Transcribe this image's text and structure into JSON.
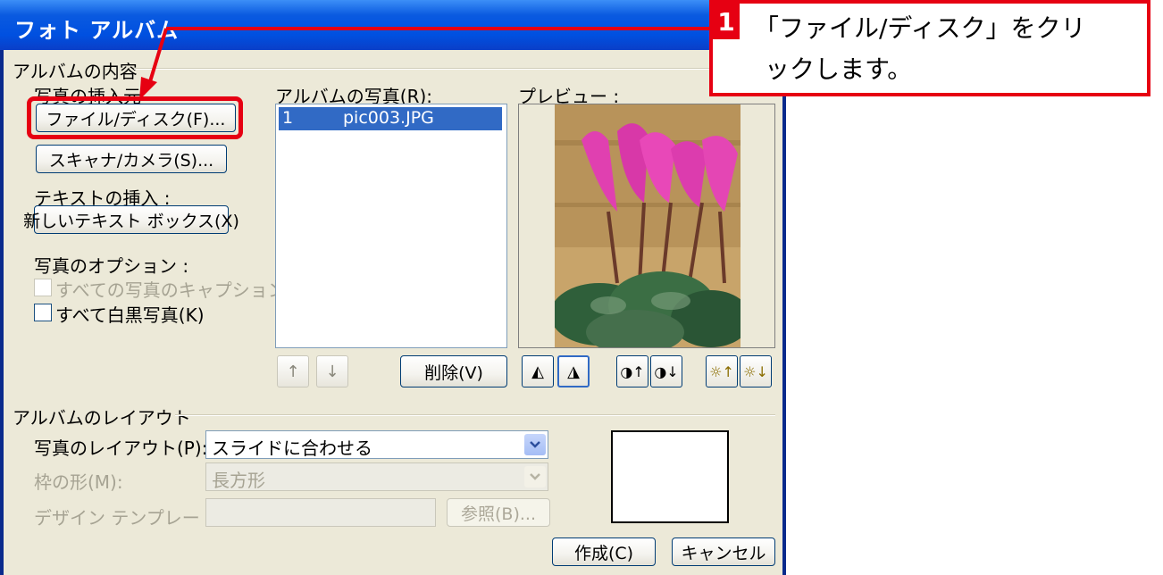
{
  "dialog": {
    "title": "フォト アルバム",
    "album_content": {
      "group_label": "アルバムの内容",
      "insert_photo_label": "写真の挿入元",
      "file_disk_button": "ファイル/ディスク(F)...",
      "scanner_camera_button": "スキャナ/カメラ(S)...",
      "insert_text_label": "テキストの挿入 :",
      "new_textbox_button": "新しいテキスト ボックス(X)",
      "photo_options_label": "写真のオプション :",
      "caption_checkbox_label": "すべての写真のキャプション(A)",
      "bw_checkbox_label": "すべて白黒写真(K)",
      "album_photos_label": "アルバムの写真(R):",
      "album_photos": [
        {
          "index": "1",
          "name": "pic003.JPG"
        }
      ],
      "preview_label": "プレビュー :",
      "move_up_icon": "move-up-arrow",
      "move_down_icon": "move-down-arrow",
      "delete_button": "削除(V)"
    },
    "album_layout": {
      "group_label": "アルバムのレイアウト",
      "photo_layout_label": "写真のレイアウト(P):",
      "photo_layout_value": "スライドに合わせる",
      "frame_shape_label": "枠の形(M):",
      "frame_shape_value": "長方形",
      "design_template_label": "デザイン テンプレート(T):",
      "design_template_value": "",
      "browse_button": "参照(B)..."
    },
    "buttons": {
      "create": "作成(C)",
      "cancel": "キャンセル"
    }
  },
  "callout": {
    "step_number": "1",
    "line1": "「ファイル/ディスク」をクリ",
    "line2": "ックします。",
    "color": "#e60012"
  },
  "colors": {
    "title_bar": "#0a5ae0",
    "selection": "#316ac5",
    "dialog_bg": "#ece9d8"
  }
}
